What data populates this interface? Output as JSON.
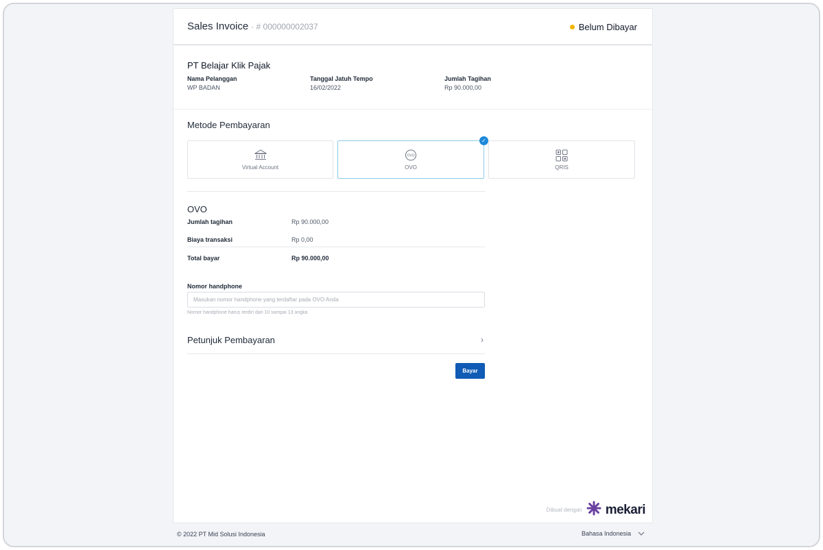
{
  "header": {
    "title": "Sales Invoice",
    "invoice_number": "· # 000000002037",
    "status": "Belum Dibayar",
    "status_color": "#f5b400"
  },
  "invoice": {
    "company": "PT Belajar Klik Pajak",
    "customer_label": "Nama Pelanggan",
    "customer_value": "WP BADAN",
    "due_date_label": "Tanggal Jatuh Tempo",
    "due_date_value": "16/02/2022",
    "amount_label": "Jumlah Tagihan",
    "amount_value": "Rp 90.000,00"
  },
  "payment": {
    "section_title": "Metode Pembayaran",
    "methods": [
      {
        "label": "Virtual Account",
        "icon": "bank-icon",
        "selected": false
      },
      {
        "label": "OVO",
        "icon": "ovo-icon",
        "selected": true
      },
      {
        "label": "QRIS",
        "icon": "qr-icon",
        "selected": false
      }
    ],
    "accent_color": "#1e88d9"
  },
  "ovo": {
    "title": "OVO",
    "rows": [
      {
        "label": "Jumlah tagihan",
        "value": "Rp 90.000,00"
      },
      {
        "label": "Biaya transaksi",
        "value": "Rp 0,00"
      },
      {
        "label": "Total bayar",
        "value": "Rp 90.000,00"
      }
    ],
    "phone_label": "Nomor handphone",
    "phone_value": "",
    "phone_placeholder": "Masukan nomor handphone yang terdaftar pada OVO Anda",
    "phone_hint": "Nomor handphone harus terdiri dari 10 sampai 13 angka"
  },
  "guide": {
    "label": "Petunjuk Pembayaran"
  },
  "actions": {
    "pay_label": "Bayar",
    "pay_color": "#0f5bb5"
  },
  "branding": {
    "made_with": "Dibuat dengan",
    "brand": "mekari"
  },
  "footer": {
    "copyright": "© 2022 PT Mid Solusi Indonesia",
    "language": "Bahasa Indonesia"
  }
}
